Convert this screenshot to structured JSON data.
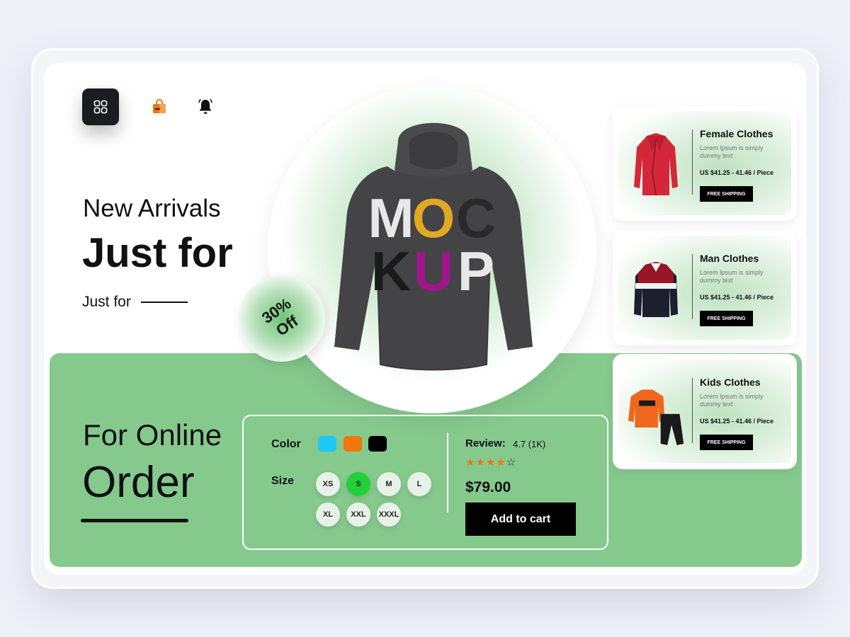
{
  "icons": {
    "menu": "grid-icon",
    "bag": "shopping-bag-icon",
    "bell": "bell-icon"
  },
  "hero": {
    "eyebrow": "New Arrivals",
    "headline": "Just for",
    "subline": "Just for",
    "discount_line1": "30%",
    "discount_line2": "Off"
  },
  "product_print": {
    "line1": [
      "M",
      "O",
      "C"
    ],
    "line2": [
      "K",
      "U",
      "P"
    ]
  },
  "order": {
    "line1": "For Online",
    "line2": "Order"
  },
  "options": {
    "color_label": "Color",
    "colors": [
      "#1ec8f5",
      "#f0760e",
      "#000000"
    ],
    "size_label": "Size",
    "sizes": [
      "XS",
      "S",
      "M",
      "L",
      "XL",
      "XXL",
      "XXXL"
    ],
    "selected_size": "S",
    "selected_size_color": "#22d13a"
  },
  "review": {
    "label": "Review:",
    "value": "4.7 (1K)",
    "rating": 4,
    "max_rating": 5,
    "star_color": "#f0760e"
  },
  "price": "$79.00",
  "add_to_cart": "Add to cart",
  "side_products": [
    {
      "title": "Female Clothes",
      "desc": "Lorem Ipsum is simply dummy text",
      "price": "US $41.25 - 41.46 / Piece",
      "cta": "FREE SHIPPING",
      "icon": "red-jacket-icon"
    },
    {
      "title": "Man Clothes",
      "desc": "Lorem Ipsum is simply dummy text",
      "price": "US $41.25 - 41.46 / Piece",
      "cta": "FREE SHIPPING",
      "icon": "polo-shirt-icon"
    },
    {
      "title": "Kids Clothes",
      "desc": "Lorem Ipsum is simply dummy text",
      "price": "US $41.25 - 41.46 / Piece",
      "cta": "FREE SHIPPING",
      "icon": "kids-tracksuit-icon"
    }
  ],
  "colors": {
    "band_green": "#86c98d",
    "dark": "#1b1c20",
    "accent_orange": "#f0760e"
  }
}
